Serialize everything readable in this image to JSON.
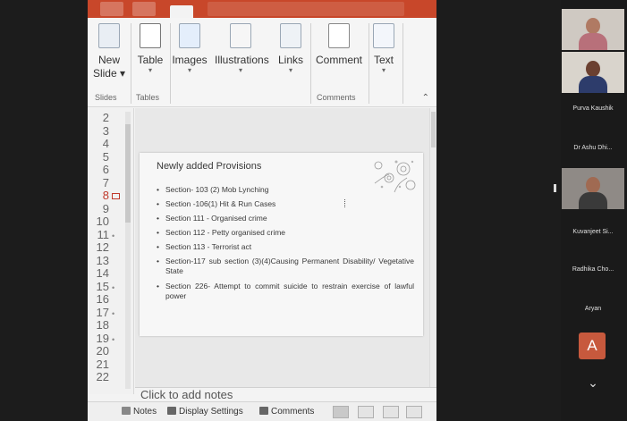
{
  "ribbon": {
    "buttons": [
      {
        "label": "New",
        "label2": "Slide ▾",
        "icon": "new-slide-icon"
      },
      {
        "label": "Table",
        "label2": "▾",
        "icon": "table-icon"
      },
      {
        "label": "Images",
        "label2": "▾",
        "icon": "images-icon"
      },
      {
        "label": "Illustrations",
        "label2": "▾",
        "icon": "illustrations-icon"
      },
      {
        "label": "Links",
        "label2": "▾",
        "icon": "links-icon"
      },
      {
        "label": "Comment",
        "label2": "",
        "icon": "comment-icon"
      },
      {
        "label": "Text",
        "label2": "▾",
        "icon": "text-icon"
      }
    ],
    "groups": {
      "slides": "Slides",
      "tables": "Tables",
      "comments": "Comments"
    }
  },
  "slide_numbers": [
    "2",
    "3",
    "4",
    "5",
    "6",
    "7",
    "8",
    "9",
    "10",
    "11",
    "12",
    "13",
    "14",
    "15",
    "16",
    "17",
    "18",
    "19",
    "20",
    "21",
    "22"
  ],
  "active_slide": "8",
  "slide": {
    "title": "Newly added Provisions",
    "bullets": [
      "Section- 103 (2) Mob Lynching",
      "Section -106(1) Hit & Run Cases",
      "Section 111 - Organised crime",
      "Section 112 - Petty organised crime",
      "Section 113 - Terrorist act",
      "Section-117 sub section (3)(4)Causing Permanent Disability/ Vegetative State",
      "Section 226- Attempt to commit suicide to restrain exercise of lawful power"
    ]
  },
  "notes_placeholder": "Click to add notes",
  "status": {
    "notes": "Notes",
    "display_settings": "Display Settings",
    "comments": "Comments"
  },
  "participants": {
    "names": [
      "Purva Kaushik",
      "Dr Ashu Dhi...",
      "Kuvanjeet Si...",
      "Radhika Cho...",
      "Aryan"
    ],
    "avatar_letter": "A"
  },
  "colors": {
    "titlebar": "#c8472a",
    "avatar": "#c7593d"
  }
}
